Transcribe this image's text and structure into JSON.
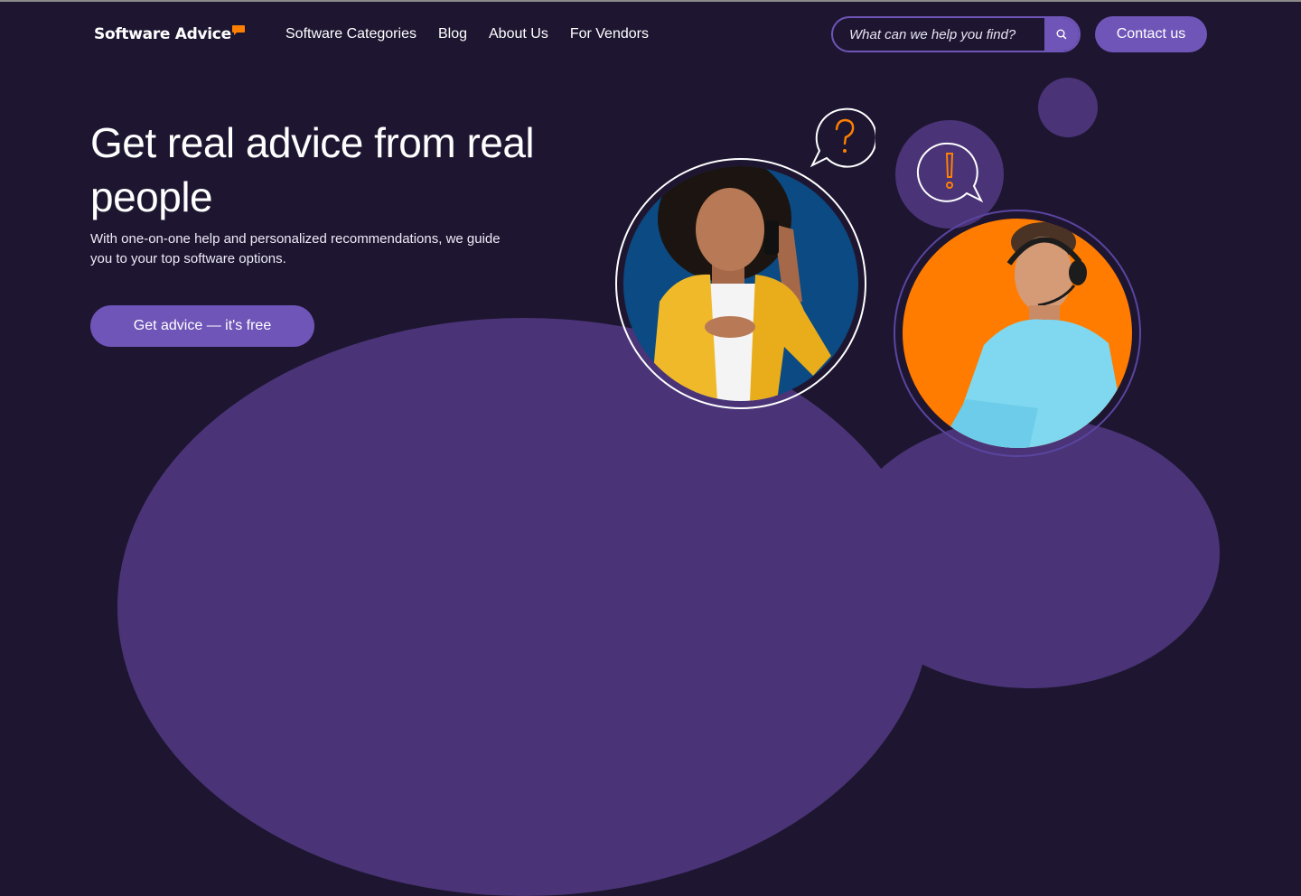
{
  "brand": {
    "name": "Software Advice"
  },
  "nav": {
    "items": [
      {
        "label": "Software Categories"
      },
      {
        "label": "Blog"
      },
      {
        "label": "About Us"
      },
      {
        "label": "For Vendors"
      }
    ]
  },
  "search": {
    "placeholder": "What can we help you find?",
    "icon": "search-icon"
  },
  "header": {
    "contact_label": "Contact us"
  },
  "hero": {
    "title": "Get real advice from real people",
    "subtitle": "With one-on-one help and personalized recommendations, we guide you to your top software options.",
    "cta_label": "Get advice — it's free"
  },
  "illustration": {
    "question_icon": "question-bubble-icon",
    "exclaim_icon": "exclamation-bubble-icon"
  },
  "colors": {
    "background": "#1e1631",
    "accent": "#6f55b8",
    "brand_orange": "#ff8000",
    "hill": "#4a3477",
    "portrait_blue": "#0b4a82"
  }
}
